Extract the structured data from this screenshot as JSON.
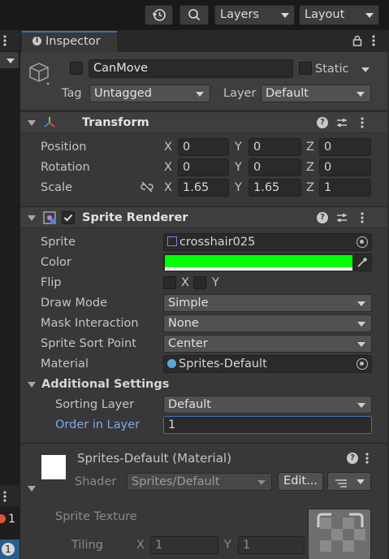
{
  "toolbar": {
    "history_icon": "history-icon",
    "search_icon": "search-icon",
    "layers_label": "Layers",
    "layout_label": "Layout"
  },
  "left_strip": {
    "badge_1": "1",
    "badge_2": "1"
  },
  "inspector": {
    "tab_label": "Inspector",
    "object_name": "CanMove",
    "static_label": "Static",
    "tag_label": "Tag",
    "tag_value": "Untagged",
    "layer_label": "Layer",
    "layer_value": "Default"
  },
  "transform": {
    "title": "Transform",
    "rows": [
      {
        "label": "Position",
        "x": "0",
        "y": "0",
        "z": "0"
      },
      {
        "label": "Rotation",
        "x": "0",
        "y": "0",
        "z": "0"
      },
      {
        "label": "Scale",
        "x": "1.65",
        "y": "1.65",
        "z": "1"
      }
    ],
    "axis_x": "X",
    "axis_y": "Y",
    "axis_z": "Z"
  },
  "sprite_renderer": {
    "title": "Sprite Renderer",
    "enabled": true,
    "sprite_label": "Sprite",
    "sprite_value": "crosshair025",
    "color_label": "Color",
    "color_value": "#00ff00",
    "flip_label": "Flip",
    "flip_x": "X",
    "flip_y": "Y",
    "draw_mode_label": "Draw Mode",
    "draw_mode_value": "Simple",
    "mask_label": "Mask Interaction",
    "mask_value": "None",
    "sort_point_label": "Sprite Sort Point",
    "sort_point_value": "Center",
    "material_label": "Material",
    "material_value": "Sprites-Default",
    "additional_label": "Additional Settings",
    "sorting_layer_label": "Sorting Layer",
    "sorting_layer_value": "Default",
    "order_label": "Order in Layer",
    "order_value": "1"
  },
  "material": {
    "title": "Sprites-Default (Material)",
    "shader_label": "Shader",
    "shader_value": "Sprites/Default",
    "edit_label": "Edit...",
    "texture_label": "Sprite Texture",
    "tiling_label": "Tiling",
    "tiling_x_label": "X",
    "tiling_x": "1",
    "tiling_y_label": "Y",
    "tiling_y": "1"
  },
  "colors": {
    "accent": "#3a72b0",
    "panel": "#383838",
    "sprite_color": "#00ff00",
    "order_label_color": "#7ea8e6"
  }
}
